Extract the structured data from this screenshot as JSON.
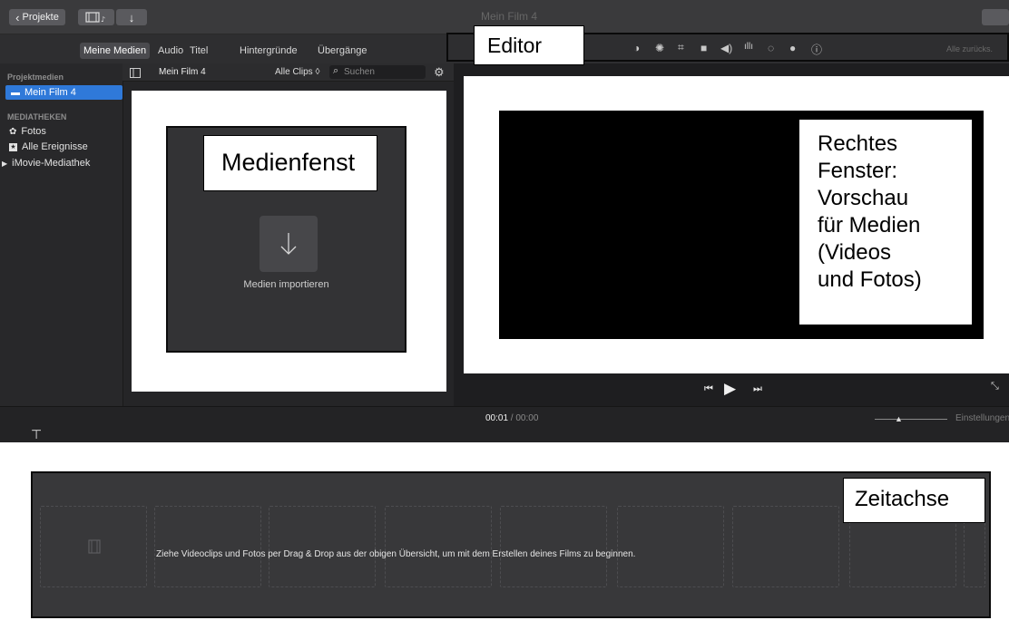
{
  "titlebar": {
    "projects_label": "Projekte",
    "projects_chevron": "‹",
    "library_icon": "film-music-icon",
    "import_icon": "download-arrow-icon",
    "window_title": "Mein Film 4"
  },
  "tabs": [
    "Meine Medien",
    "Audio",
    "Titel",
    "Hintergründe",
    "Übergänge"
  ],
  "sidebar": {
    "section_project": "Projektmedien",
    "project_item": "Mein Film 4",
    "section_libraries": "MEDIATHEKEN",
    "items": [
      "Fotos",
      "Alle Ereignisse",
      "iMovie-Mediathek"
    ]
  },
  "media": {
    "toolbar_title": "Mein Film 4",
    "clips_filter": "Alle Clips ◊",
    "search_placeholder": "Suchen",
    "import_label": "Medien importieren"
  },
  "editor": {
    "reset_label": "Alle zurücks."
  },
  "viewer": {
    "timecode_current": "00:01",
    "timecode_sep": " / ",
    "timecode_total": "00:00"
  },
  "timeline": {
    "settings_label": "Einstellungen",
    "hint": "Ziehe Videoclips und Fotos per Drag & Drop aus der obigen Übersicht, um mit dem Erstellen deines Films zu beginnen."
  },
  "annotations": {
    "editor": "Editor",
    "media": "Medienfenst",
    "right": "Rechtes\nFenster:\nVorschau\nfür Medien\n(Videos\nund Fotos)",
    "timeline": "Zeitachse"
  },
  "colors": {
    "accent": "#2f79d9",
    "chrome": "#3a3a3c",
    "panel": "#252527"
  }
}
